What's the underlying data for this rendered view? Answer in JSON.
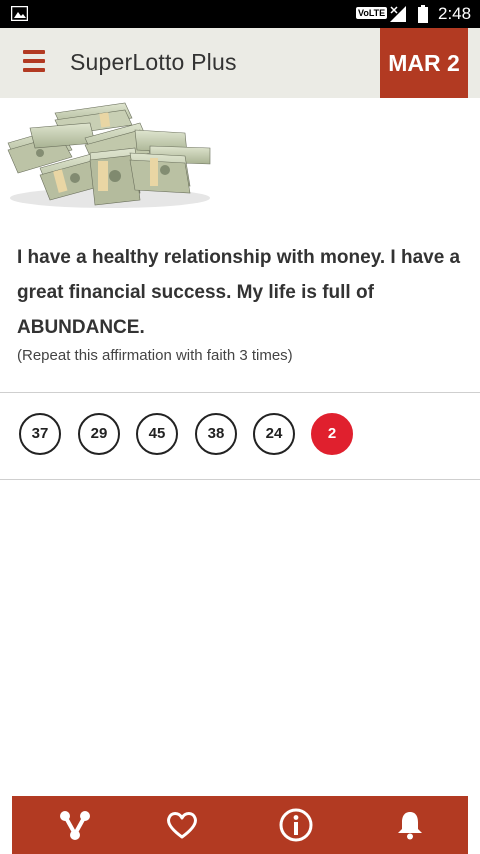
{
  "status_bar": {
    "volte": "VoLTE",
    "time": "2:48"
  },
  "app_bar": {
    "title": "SuperLotto Plus",
    "date": "MAR 2"
  },
  "affirmation": {
    "text": "I have a healthy relationship with money. I have a great financial success. My life is full of ABUNDANCE.",
    "note": "(Repeat this affirmation with faith 3 times)"
  },
  "numbers": {
    "main": [
      "37",
      "29",
      "45",
      "38",
      "24"
    ],
    "bonus": "2"
  },
  "bottom_nav": {
    "items": [
      "share-icon",
      "heart-icon",
      "info-icon",
      "bell-icon"
    ]
  },
  "colors": {
    "accent": "#b23a22",
    "bonus_ball": "#e0202e",
    "app_bar_bg": "#ebebe5"
  }
}
